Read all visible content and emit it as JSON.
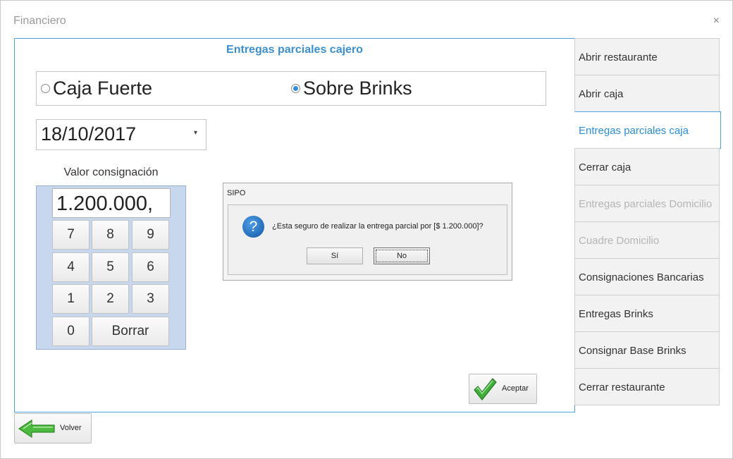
{
  "window": {
    "title": "Financiero",
    "close_glyph": "×"
  },
  "panel": {
    "title": "Entregas parciales cajero"
  },
  "radio": {
    "options": [
      {
        "label": "Caja Fuerte",
        "checked": false
      },
      {
        "label": "Sobre Brinks",
        "checked": true
      }
    ]
  },
  "date": {
    "value": "18/10/2017",
    "caret": "▾"
  },
  "keypad": {
    "label": "Valor consignación",
    "display": "1.200.000,",
    "keys": [
      "7",
      "8",
      "9",
      "4",
      "5",
      "6",
      "1",
      "2",
      "3",
      "0",
      "Borrar"
    ]
  },
  "dialog": {
    "title": "SIPO",
    "icon": "question-icon",
    "icon_glyph": "?",
    "message": "¿Esta seguro de realizar la entrega parcial por [$ 1.200.000]?",
    "yes_label": "Sí",
    "no_label": "No"
  },
  "buttons": {
    "accept_label": "Aceptar",
    "back_label": "Volver"
  },
  "nav": {
    "items": [
      {
        "label": "Abrir restaurante",
        "state": "normal"
      },
      {
        "label": "Abrir caja",
        "state": "normal"
      },
      {
        "label": "Entregas parciales caja",
        "state": "active"
      },
      {
        "label": "Cerrar caja",
        "state": "normal"
      },
      {
        "label": "Entregas parciales Domicilio",
        "state": "disabled"
      },
      {
        "label": "Cuadre Domicilio",
        "state": "disabled"
      },
      {
        "label": "Consignaciones Bancarias",
        "state": "normal"
      },
      {
        "label": "Entregas Brinks",
        "state": "normal"
      },
      {
        "label": "Consignar Base Brinks",
        "state": "normal"
      },
      {
        "label": "Cerrar restaurante",
        "state": "normal"
      }
    ]
  },
  "colors": {
    "accent": "#2a8fdb",
    "keypad_bg": "#c7d7ed",
    "disabled_text": "#b5b5b5"
  }
}
